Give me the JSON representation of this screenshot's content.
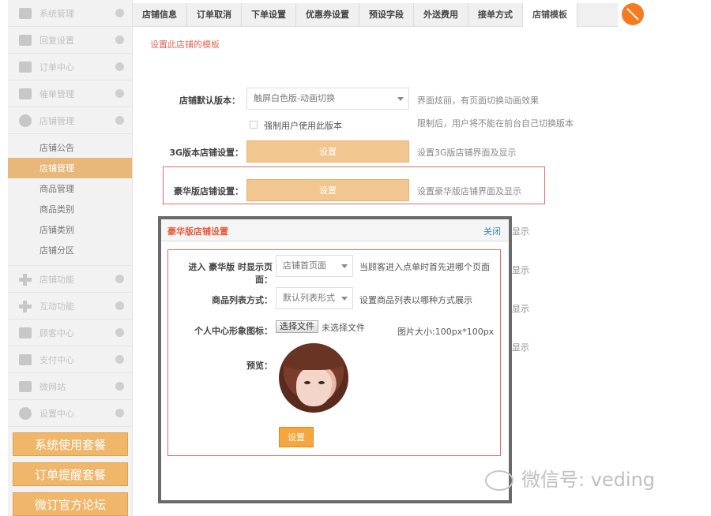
{
  "sidebar": {
    "items": [
      {
        "label": "系统管理"
      },
      {
        "label": "回复设置"
      },
      {
        "label": "订单中心"
      },
      {
        "label": "催单管理"
      },
      {
        "label": "店铺管理"
      }
    ],
    "subitems": [
      {
        "label": "店铺公告"
      },
      {
        "label": "店铺管理"
      },
      {
        "label": "商品管理"
      },
      {
        "label": "商品类别"
      },
      {
        "label": "店铺类别"
      },
      {
        "label": "店铺分区"
      }
    ],
    "items2": [
      {
        "label": "店铺功能"
      },
      {
        "label": "互动功能"
      },
      {
        "label": "顾客中心"
      },
      {
        "label": "支付中心"
      },
      {
        "label": "微网站"
      },
      {
        "label": "设置中心"
      }
    ],
    "packages": [
      "系统使用套餐",
      "订单提醒套餐",
      "微订官方论坛"
    ]
  },
  "tabs": [
    "店铺信息",
    "订单取消",
    "下单设置",
    "优惠券设置",
    "预设字段",
    "外送费用",
    "接单方式",
    "店铺模板"
  ],
  "breadcrumb": "设置此店铺的模板",
  "form": {
    "default_version_label": "店铺默认版本：",
    "default_version_value": "触屏白色版-动画切换",
    "default_version_hint": "界面炫丽，有页面切换动画效果",
    "force_label": "强制用户使用此版本",
    "force_hint": "限制后，用户将不能在前台自己切换版本",
    "v3g_label": "3G版本店铺设置：",
    "v3g_btn": "设置",
    "v3g_hint": "设置3G版店铺界面及显示",
    "lux_label": "豪华版店铺设置：",
    "lux_btn": "设置",
    "lux_hint": "设置豪华版店铺界面及显示",
    "hidden_hint_suffix": "显示"
  },
  "modal": {
    "title": "豪华版店铺设置",
    "close": "关闭",
    "entry_label": "进入 豪华版 时显示页面：",
    "entry_value": "店铺首页面",
    "entry_hint": "当顾客进入点单时首先进哪个页面",
    "list_label": "商品列表方式：",
    "list_value": "默认列表形式",
    "list_hint": "设置商品列表以哪种方式展示",
    "icon_label": "个人中心形象图标：",
    "file_btn": "选择文件",
    "file_status": "未选择文件",
    "size_hint": "图片大小:100px*100px",
    "preview_label": "预览：",
    "submit": "设置"
  },
  "watermark": "微信号: veding"
}
